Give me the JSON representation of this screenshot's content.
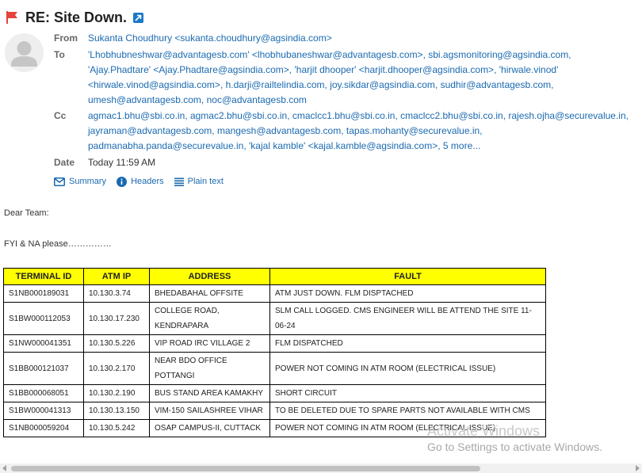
{
  "message": {
    "subject": "RE: Site Down.",
    "headers": {
      "from_label": "From",
      "to_label": "To",
      "cc_label": "Cc",
      "date_label": "Date",
      "from": "Sukanta Choudhury <sukanta.choudhury@agsindia.com>",
      "to": [
        "'Lhobhubneshwar@advantagesb.com' <lhobhubaneshwar@advantagesb.com>,",
        "sbi.agsmonitoring@agsindia.com,",
        "'Ajay.Phadtare' <Ajay.Phadtare@agsindia.com>,",
        "'harjit dhooper' <harjit.dhooper@agsindia.com>,",
        "'hirwale.vinod' <hirwale.vinod@agsindia.com>,",
        "h.darji@railtelindia.com,",
        "joy.sikdar@agsindia.com,",
        "sudhir@advantagesb.com,",
        "umesh@advantagesb.com,",
        "noc@advantagesb.com"
      ],
      "cc": [
        "agmac1.bhu@sbi.co.in,",
        "agmac2.bhu@sbi.co.in,",
        "cmaclcc1.bhu@sbi.co.in,",
        "cmaclcc2.bhu@sbi.co.in,",
        "rajesh.ojha@securevalue.in,",
        "jayraman@advantagesb.com,",
        "mangesh@advantagesb.com,",
        "tapas.mohanty@securevalue.in,",
        "padmanabha.panda@securevalue.in,",
        "'kajal kamble' <kajal.kamble@agsindia.com>,"
      ],
      "cc_more": "5 more...",
      "date": "Today 11:59 AM"
    },
    "views": {
      "summary": "Summary",
      "headers": "Headers",
      "plain_text": "Plain text"
    },
    "body": {
      "greeting": "Dear Team:",
      "note": "FYI & NA please……………"
    }
  },
  "table": {
    "columns": [
      "TERMINAL ID",
      "ATM IP",
      "ADDRESS",
      "FAULT"
    ],
    "rows": [
      [
        "S1NB000189031",
        "10.130.3.74",
        "BHEDABAHAL OFFSITE",
        "ATM JUST DOWN. FLM DISPTACHED"
      ],
      [
        "S1BW000112053",
        "10.130.17.230",
        "COLLEGE ROAD, KENDRAPARA",
        "SLM CALL LOGGED. CMS ENGINEER WILL BE ATTEND THE SITE 11-06-24"
      ],
      [
        "S1NW000041351",
        "10.130.5.226",
        "VIP ROAD IRC VILLAGE 2",
        "FLM DISPATCHED"
      ],
      [
        "S1BB000121037",
        "10.130.2.170",
        "NEAR BDO OFFICE POTTANGI",
        "POWER NOT COMING IN ATM ROOM (ELECTRICAL ISSUE)"
      ],
      [
        "S1BB000068051",
        "10.130.2.190",
        "BUS STAND AREA KAMAKHY",
        "SHORT CIRCUIT"
      ],
      [
        "S1BW000041313",
        "10.130.13.150",
        "VIM-150 SAILASHREE VIHAR",
        "TO BE DELETED DUE TO SPARE PARTS NOT AVAILABLE WITH CMS"
      ],
      [
        "S1NB000059204",
        "10.130.5.242",
        "OSAP CAMPUS-II, CUTTACK",
        "POWER NOT COMING IN ATM ROOM (ELECTRICAL ISSUE)"
      ]
    ]
  },
  "watermark": {
    "line1": "Activate Windows",
    "line2": "Go to Settings to activate Windows."
  },
  "colors": {
    "link": "#1b6ab0",
    "flag": "#e8413c",
    "header_fill": "#ffff00"
  },
  "icons": [
    "flag-icon",
    "popout-icon",
    "avatar-person-icon",
    "envelope-icon",
    "info-icon",
    "list-icon"
  ]
}
